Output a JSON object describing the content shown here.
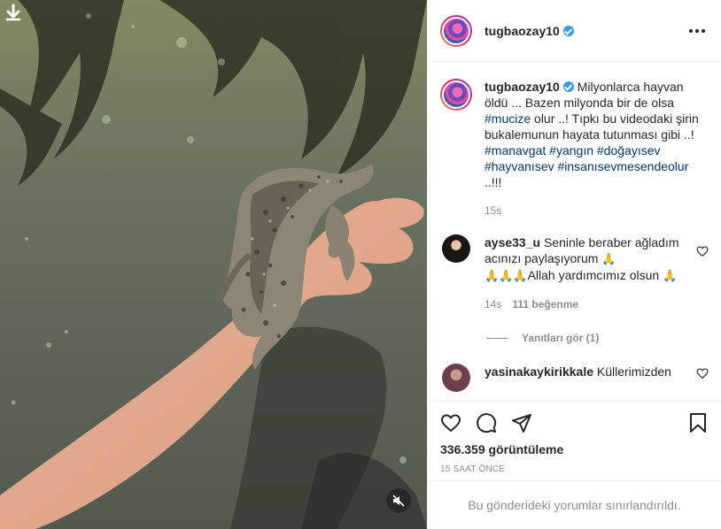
{
  "post": {
    "username": "tugbaozay10",
    "verified": true,
    "more_icon": "more-horizontal-icon"
  },
  "caption": {
    "username": "tugbaozay10",
    "text_1": "Milyonlarca hayvan öldü ... Bazen milyonda bir de olsa",
    "hashtag_mucize": "#mucize",
    "text_2": "olur ..! Tıpkı bu videodaki şirin bukalemunun hayata tutunması gibi ..!",
    "hashtags": [
      "#manavgat",
      "#yangın",
      "#doğayısev",
      "#hayvanısev",
      "#insanısevmesendeolur"
    ],
    "text_3": "..!!!",
    "time": "15s"
  },
  "comments": [
    {
      "username": "ayse33_u",
      "text_1": "Seninle beraber ağladım acınızı paylaşıyorum",
      "emoji_pray": "🙏",
      "emoji_triple": "🙏🙏🙏",
      "text_2": "Allah yardımcımız olsun",
      "time": "14s",
      "likes": "111 beğenme",
      "view_replies": "Yanıtları gör (1)"
    },
    {
      "username": "yasinakaykirikkale",
      "text": "Küllerimizden"
    }
  ],
  "actions": {
    "icons": [
      "heart-icon",
      "comment-icon",
      "share-icon",
      "bookmark-icon"
    ]
  },
  "stats": {
    "views": "336.359 görüntüleme",
    "time_ago": "15 SAAT ÖNCE"
  },
  "footer": {
    "comments_limited": "Bu gönderideki yorumlar sınırlandırıldı."
  },
  "colors": {
    "verified": "#3897f0",
    "hashtag": "#00376b",
    "muted": "#8e8e8e",
    "text": "#262626"
  }
}
